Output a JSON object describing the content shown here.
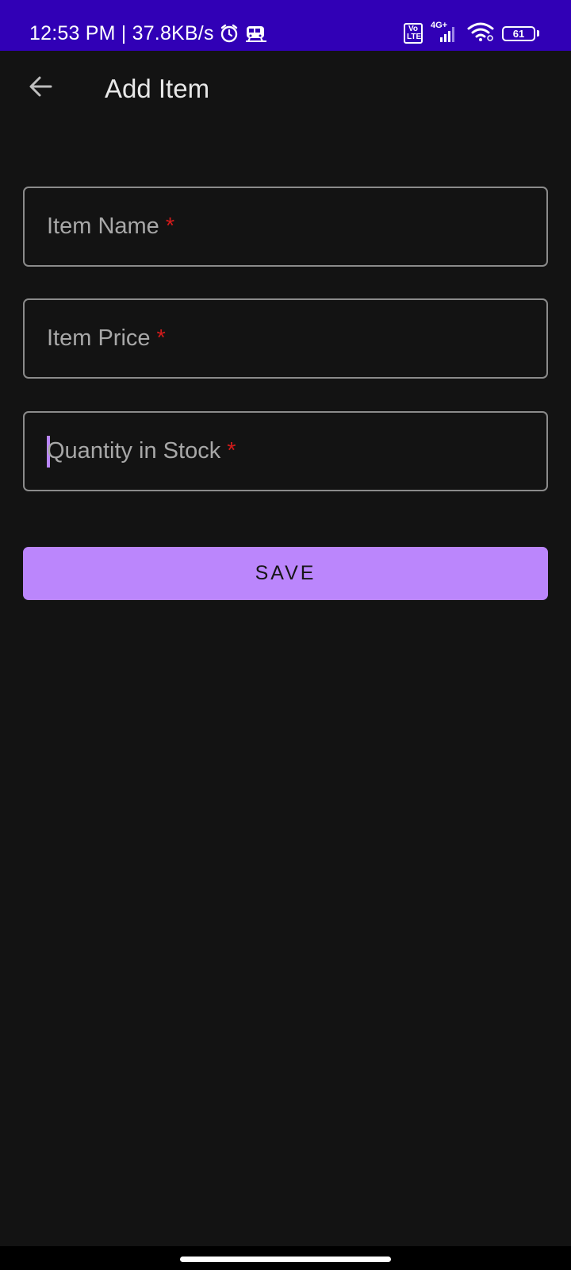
{
  "status_bar": {
    "time_speed": "12:53 PM | 37.8KB/s",
    "volte": "Vo\nLTE",
    "network_type": "4G+",
    "battery": "61",
    "icons": [
      "alarm-icon",
      "train-icon",
      "volte-icon",
      "signal-icon",
      "wifi-icon",
      "battery-icon"
    ]
  },
  "app_bar": {
    "back_icon": "arrow-left-icon",
    "title": "Add Item"
  },
  "form": {
    "fields": [
      {
        "label": "Item Name",
        "required_mark": "*",
        "value": ""
      },
      {
        "label": "Item Price",
        "required_mark": "*",
        "value": ""
      },
      {
        "label": "Quantity in Stock",
        "required_mark": "*",
        "value": "",
        "focused": true
      }
    ],
    "save_label": "SAVE"
  },
  "colors": {
    "status_bar_bg": "#3100b6",
    "background": "#131313",
    "accent": "#bb86fc",
    "required": "#d11b1b"
  }
}
